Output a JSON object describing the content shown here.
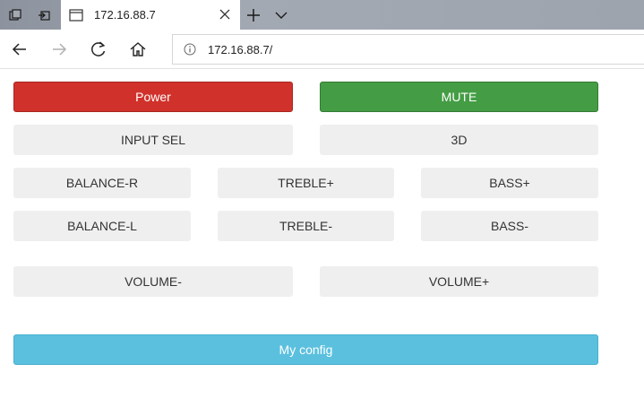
{
  "browser": {
    "tab_title": "172.16.88.7",
    "url": "172.16.88.7/"
  },
  "controls": {
    "power": "Power",
    "mute": "MUTE",
    "input_sel": "INPUT SEL",
    "three_d": "3D",
    "balance_r": "BALANCE-R",
    "treble_up": "TREBLE+",
    "bass_up": "BASS+",
    "balance_l": "BALANCE-L",
    "treble_down": "TREBLE-",
    "bass_down": "BASS-",
    "volume_down": "VOLUME-",
    "volume_up": "VOLUME+",
    "my_config": "My config"
  },
  "colors": {
    "power": "#d0322b",
    "mute": "#449d44",
    "my_config": "#5bc0de",
    "default_button": "#efefef"
  },
  "icons": {
    "tab_actions": "tab-actions-icon",
    "set_aside_tabs": "set-aside-tabs-icon",
    "page": "page-icon",
    "close": "close-icon",
    "new_tab": "plus-icon",
    "tab_menu": "chevron-down-icon",
    "back": "back-arrow-icon",
    "forward": "forward-arrow-icon",
    "refresh": "refresh-icon",
    "home": "home-icon",
    "info": "info-icon"
  }
}
